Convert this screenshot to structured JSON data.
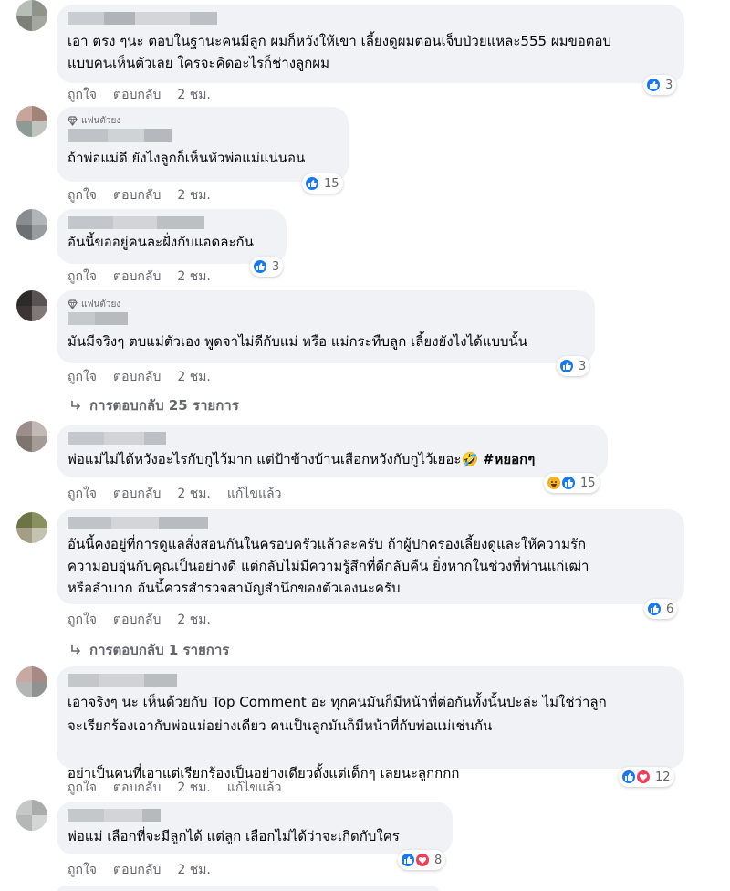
{
  "comments": [
    {
      "fan": false,
      "text": "เอา ตรง ๆนะ ตอบในฐานะคนมีลูก ผมก็หวังให้เขา เลี้ยงดูผมตอนเจ็บป่วยแหละ555 ผมขอตอบ\nแบบคนเห็นตัวเลย ใครจะคิดอะไรก็ช่างลูกผม",
      "like": "ถูกใจ",
      "reply": "ตอบกลับ",
      "time": "2 ชม.",
      "edited": "",
      "count": "3",
      "icons": [
        "like"
      ]
    },
    {
      "fan": true,
      "text": "ถ้าพ่อแม่ดี ยังไงลูกก็เห็นหัวพ่อแม่แน่นอน",
      "like": "ถูกใจ",
      "reply": "ตอบกลับ",
      "time": "2 ชม.",
      "edited": "",
      "count": "15",
      "icons": [
        "like"
      ]
    },
    {
      "fan": false,
      "text": "อันนี้ขออยู่คนละฝั่งกับแอดละกัน",
      "like": "ถูกใจ",
      "reply": "ตอบกลับ",
      "time": "2 ชม.",
      "edited": "",
      "count": "3",
      "icons": [
        "like"
      ]
    },
    {
      "fan": true,
      "text": "มันมีจริงๆ ตบแม่ตัวเอง พูดจาไม่ดีกับแม่ หรือ แม่กระทืบลูก เลี้ยงยังไงได้แบบนั้น",
      "like": "ถูกใจ",
      "reply": "ตอบกลับ",
      "time": "2 ชม.",
      "edited": "",
      "count": "3",
      "icons": [
        "like"
      ],
      "replies": "การตอบกลับ 25 รายการ"
    },
    {
      "fan": false,
      "text": "พ่อแม่ไม่ได้หวังอะไรกับกูไว้มาก แต่ป้าข้างบ้านเสือกหวังกับกูไว้เยอะ🤣 ",
      "tag": "#หยอกๆ",
      "like": "ถูกใจ",
      "reply": "ตอบกลับ",
      "time": "2 ชม.",
      "edited": "แก้ไขแล้ว",
      "count": "15",
      "icons": [
        "haha",
        "like"
      ]
    },
    {
      "fan": false,
      "text": "อันนี้คงอยู่ที่การดูแลสั่งสอนกันในครอบครัวแล้วละครับ ถ้าผู้ปกครองเลี้ยงดูและให้ความรัก\nความอบอุ่นกับคุณเป็นอย่างดี แต่กลับไม่มีความรู้สึกที่ดีกลับคืน ยิ่งหากในช่วงที่ท่านแก่เฒ่า\nหรือลำบาก อันนี้ควรสำรวจสามัญสำนึกของตัวเองนะครับ",
      "like": "ถูกใจ",
      "reply": "ตอบกลับ",
      "time": "2 ชม.",
      "edited": "",
      "count": "6",
      "icons": [
        "like"
      ],
      "replies": "การตอบกลับ 1 รายการ"
    },
    {
      "fan": false,
      "text": "เอาจริงๆ นะ เห็นด้วยกับ Top Comment อะ ทุกคนมันก็มีหน้าที่ต่อกันทั้งนั้นปะล่ะ ไม่ใช่ว่าลูก\nจะเรียกร้องเอากับพ่อแม่อย่างเดียว คนเป็นลูกมันก็มีหน้าที่กับพ่อแม่เช่นกัน\n\nอย่าเป็นคนที่เอาแต่เรียกร้องเป็นอย่างเดียวตั้งแต่เด็กๆ เลยนะลูกกกก",
      "like": "ถูกใจ",
      "reply": "ตอบกลับ",
      "time": "2 ชม.",
      "edited": "แก้ไขแล้ว",
      "count": "12",
      "icons": [
        "like",
        "love"
      ]
    },
    {
      "fan": false,
      "text": "พ่อแม่ เลือกที่จะมีลูกได้ แต่ลูก เลือกไม่ได้ว่าจะเกิดกับใคร",
      "like": "ถูกใจ",
      "reply": "ตอบกลับ",
      "time": "2 ชม.",
      "edited": "",
      "count": "8",
      "icons": [
        "like",
        "love"
      ]
    }
  ],
  "fan_label": "แฟนตัวยง",
  "colors": {
    "like": "#1877f2",
    "love": "#f33e58",
    "haha": "#f7b125",
    "bubble": "#f0f2f5",
    "meta": "#65676b"
  }
}
